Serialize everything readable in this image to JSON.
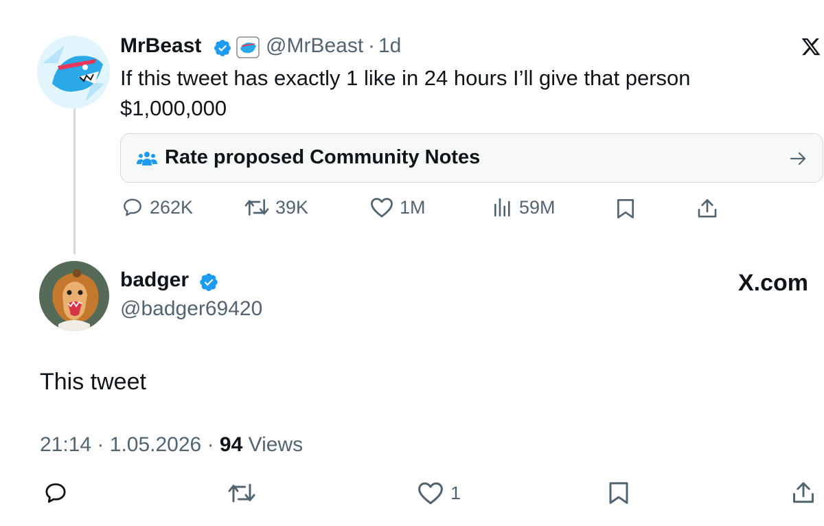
{
  "parent_tweet": {
    "author_name": "MrBeast",
    "handle": "@MrBeast",
    "separator": "·",
    "age": "1d",
    "text_line1": "If this tweet has exactly 1 like in 24 hours I’ll give that person",
    "text_line2": "$1,000,000",
    "community_notes_label": "Rate proposed Community Notes",
    "metrics": {
      "replies": "262K",
      "reposts": "39K",
      "likes": "1M",
      "views": "59M"
    }
  },
  "reply_tweet": {
    "author_name": "badger",
    "handle": "@badger69420",
    "brand": "X.com",
    "text": "This tweet",
    "time": "21:14",
    "separator": "·",
    "date": "1.05.2026",
    "separator2": "·",
    "views_count": "94",
    "views_label": "Views",
    "likes": "1"
  },
  "colors": {
    "verified_blue": "#1d9bf0",
    "text": "#0f1419",
    "muted": "#536471",
    "border": "#cfd9de"
  }
}
